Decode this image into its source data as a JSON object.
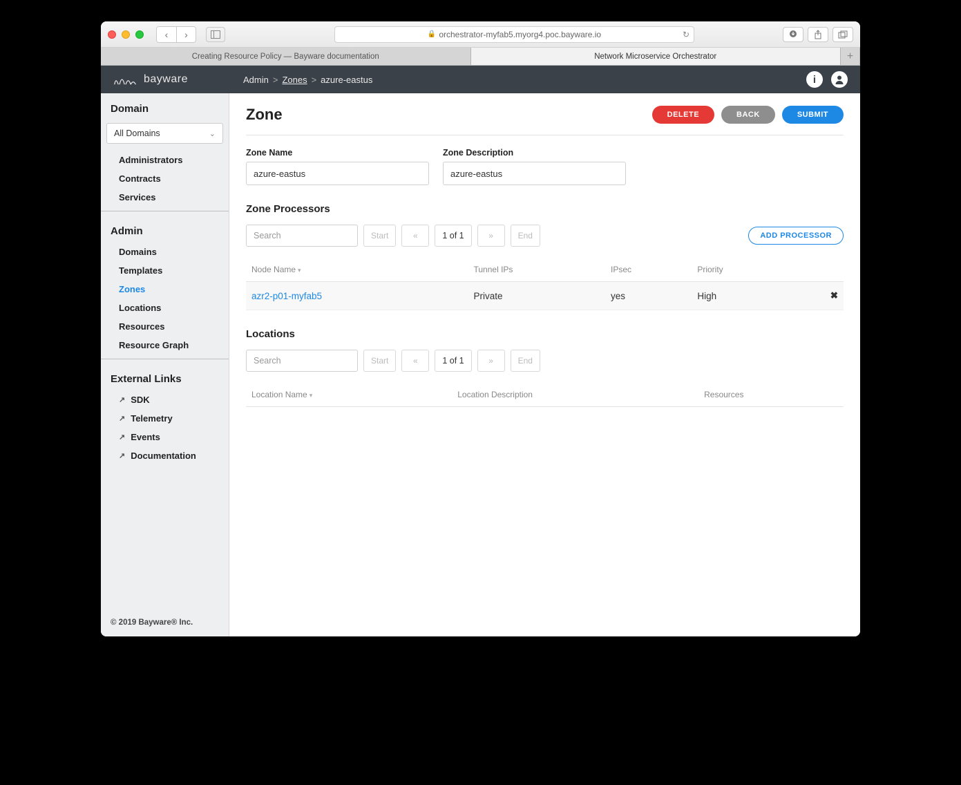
{
  "browser": {
    "url": "orchestrator-myfab5.myorg4.poc.bayware.io",
    "tabs": [
      "Creating Resource Policy — Bayware documentation",
      "Network Microservice Orchestrator"
    ]
  },
  "header": {
    "brand": "bayware",
    "breadcrumb": {
      "admin": "Admin",
      "zones": "Zones",
      "current": "azure-eastus"
    }
  },
  "sidebar": {
    "domain_title": "Domain",
    "domain_select": "All Domains",
    "domain_items": [
      "Administrators",
      "Contracts",
      "Services"
    ],
    "admin_title": "Admin",
    "admin_items": [
      "Domains",
      "Templates",
      "Zones",
      "Locations",
      "Resources",
      "Resource Graph"
    ],
    "admin_active_index": 2,
    "ext_title": "External Links",
    "ext_items": [
      "SDK",
      "Telemetry",
      "Events",
      "Documentation"
    ],
    "footer": "© 2019 Bayware® Inc."
  },
  "page": {
    "title": "Zone",
    "buttons": {
      "delete": "DELETE",
      "back": "BACK",
      "submit": "SUBMIT"
    },
    "zone_name_label": "Zone Name",
    "zone_name_value": "azure-eastus",
    "zone_desc_label": "Zone Description",
    "zone_desc_value": "azure-eastus",
    "processors": {
      "title": "Zone Processors",
      "search_placeholder": "Search",
      "start": "Start",
      "prev": "«",
      "page": "1 of 1",
      "next": "»",
      "end": "End",
      "add": "ADD PROCESSOR",
      "cols": {
        "node": "Node Name",
        "tunnel": "Tunnel IPs",
        "ipsec": "IPsec",
        "priority": "Priority"
      },
      "rows": [
        {
          "node": "azr2-p01-myfab5",
          "tunnel": "Private",
          "ipsec": "yes",
          "priority": "High"
        }
      ]
    },
    "locations": {
      "title": "Locations",
      "search_placeholder": "Search",
      "start": "Start",
      "prev": "«",
      "page": "1 of 1",
      "next": "»",
      "end": "End",
      "cols": {
        "name": "Location Name",
        "desc": "Location Description",
        "res": "Resources"
      }
    }
  }
}
